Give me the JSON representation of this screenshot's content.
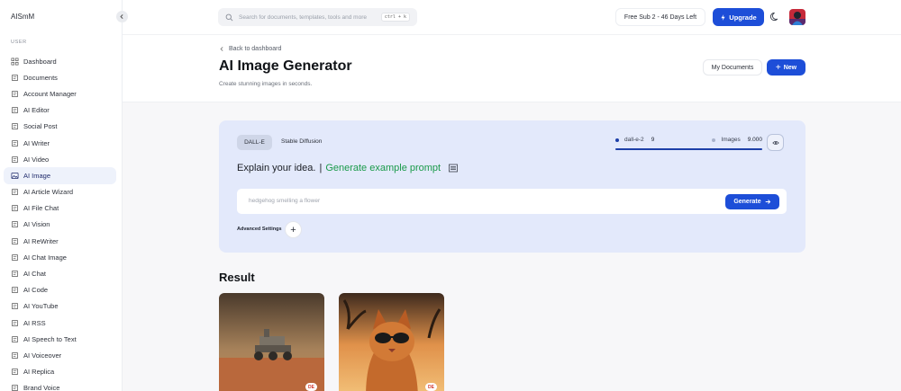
{
  "app": {
    "brand": "AISmM"
  },
  "sidebar": {
    "section_label": "USER",
    "items": [
      {
        "label": "Dashboard",
        "icon": "dashboard-icon",
        "active": false
      },
      {
        "label": "Documents",
        "icon": "documents-icon",
        "active": false
      },
      {
        "label": "Account Manager",
        "icon": "account-manager-icon",
        "active": false
      },
      {
        "label": "AI Editor",
        "icon": "editor-icon",
        "active": false
      },
      {
        "label": "Social Post",
        "icon": "social-post-icon",
        "active": false
      },
      {
        "label": "AI Writer",
        "icon": "writer-icon",
        "active": false
      },
      {
        "label": "AI Video",
        "icon": "video-icon",
        "active": false
      },
      {
        "label": "AI Image",
        "icon": "image-icon",
        "active": true
      },
      {
        "label": "AI Article Wizard",
        "icon": "article-wizard-icon",
        "active": false
      },
      {
        "label": "AI File Chat",
        "icon": "file-chat-icon",
        "active": false
      },
      {
        "label": "AI Vision",
        "icon": "vision-icon",
        "active": false
      },
      {
        "label": "AI ReWriter",
        "icon": "rewriter-icon",
        "active": false
      },
      {
        "label": "AI Chat Image",
        "icon": "chat-image-icon",
        "active": false
      },
      {
        "label": "AI Chat",
        "icon": "chat-icon",
        "active": false
      },
      {
        "label": "AI Code",
        "icon": "code-icon",
        "active": false
      },
      {
        "label": "AI YouTube",
        "icon": "youtube-icon",
        "active": false
      },
      {
        "label": "AI RSS",
        "icon": "rss-icon",
        "active": false
      },
      {
        "label": "AI Speech to Text",
        "icon": "microphone-icon",
        "active": false
      },
      {
        "label": "AI Voiceover",
        "icon": "speaker-icon",
        "active": false
      },
      {
        "label": "AI Replica",
        "icon": "replica-icon",
        "active": false
      },
      {
        "label": "Brand Voice",
        "icon": "brand-voice-icon",
        "active": false
      }
    ]
  },
  "header": {
    "search_placeholder": "Search for documents, templates, tools and more",
    "search_shortcut": "ctrl + k",
    "plan_badge": "Free Sub 2 - 46 Days Left",
    "upgrade_label": "Upgrade"
  },
  "page": {
    "back_label": "Back to dashboard",
    "title": "AI Image Generator",
    "subtitle": "Create stunning images in seconds.",
    "my_documents_label": "My Documents",
    "new_label": "New"
  },
  "generator": {
    "tabs": [
      {
        "label": "DALL-E",
        "active": true
      },
      {
        "label": "Stable Diffusion",
        "active": false
      }
    ],
    "usage": {
      "model_label": "dall-e-2",
      "model_value": "9",
      "images_label": "Images",
      "images_value": "9.000",
      "progress": 1.0,
      "model_dot_color": "#1d3fa8",
      "images_dot_color": "#a9b3cc"
    },
    "heading": "Explain your idea.",
    "heading_separator": "|",
    "example_link": "Generate example prompt",
    "prompt_placeholder": "hedgehog smelling a flower",
    "generate_label": "Generate",
    "advanced_label": "Advanced Settings"
  },
  "result": {
    "title": "Result",
    "images": [
      {
        "alt": "mars-rover",
        "badge": "DE"
      },
      {
        "alt": "cat-with-sunglasses",
        "badge": "DE"
      }
    ]
  },
  "colors": {
    "accent": "#1d4ed8",
    "card_bg": "#e3e9fb",
    "link_green": "#1a9a4a"
  }
}
